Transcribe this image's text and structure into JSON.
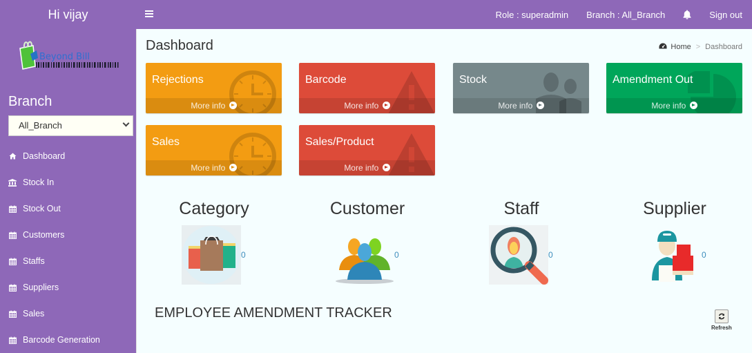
{
  "header": {
    "greeting": "Hi vijay",
    "role": "Role : superadmin",
    "branch": "Branch : All_Branch",
    "sign_out": "Sign out",
    "accent": "#8e68b8"
  },
  "sidebar": {
    "logo_text": "Beyond Bill",
    "branch_label": "Branch",
    "branch_select": {
      "selected": "All_Branch"
    },
    "items": [
      {
        "label": "Dashboard",
        "icon": "home-icon"
      },
      {
        "label": "Stock In",
        "icon": "bank-icon"
      },
      {
        "label": "Stock Out",
        "icon": "calendar-icon"
      },
      {
        "label": "Customers",
        "icon": "calendar-icon"
      },
      {
        "label": "Staffs",
        "icon": "calendar-icon"
      },
      {
        "label": "Suppliers",
        "icon": "calendar-icon"
      },
      {
        "label": "Sales",
        "icon": "calendar-icon"
      },
      {
        "label": "Barcode Generation",
        "icon": "calendar-icon"
      }
    ]
  },
  "page": {
    "title": "Dashboard",
    "breadcrumb": {
      "home": "Home",
      "current": "Dashboard"
    }
  },
  "tiles": [
    {
      "title": "Rejections",
      "link": "More info",
      "color": "#f39c12",
      "icon": "clock-icon"
    },
    {
      "title": "Barcode",
      "link": "More info",
      "color": "#dd4b39",
      "icon": "warning-icon"
    },
    {
      "title": "Stock",
      "link": "More info",
      "color": "#76888b",
      "icon": "users-icon"
    },
    {
      "title": "Amendment Out",
      "link": "More info",
      "color": "#00a65a",
      "icon": "pie-chart-icon"
    },
    {
      "title": "Sales",
      "link": "More info",
      "color": "#f39c12",
      "icon": "clock-icon"
    },
    {
      "title": "Sales/Product",
      "link": "More info",
      "color": "#dd4b39",
      "icon": "warning-icon"
    }
  ],
  "stats": [
    {
      "title": "Category",
      "count": "0",
      "icon": "shopping-bags-icon"
    },
    {
      "title": "Customer",
      "count": "0",
      "icon": "customers-group-icon"
    },
    {
      "title": "Staff",
      "count": "0",
      "icon": "staff-search-icon"
    },
    {
      "title": "Supplier",
      "count": "0",
      "icon": "supplier-delivery-icon"
    }
  ],
  "tracker": {
    "title": "EMPLOYEE AMENDMENT TRACKER",
    "refresh_label": "Refresh"
  }
}
